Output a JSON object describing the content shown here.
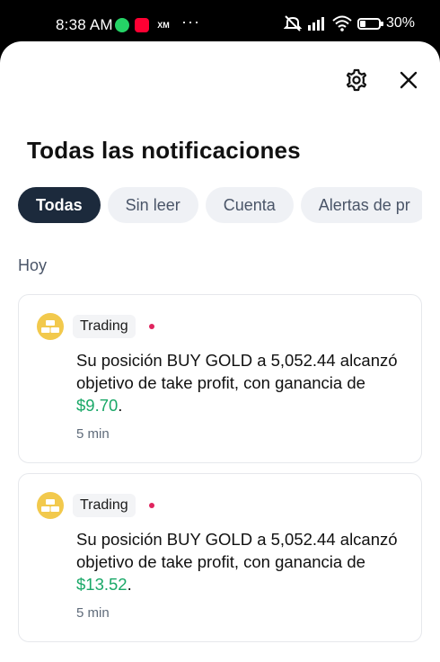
{
  "status_bar": {
    "time": "8:38 AM",
    "apps": [
      "whatsapp-icon",
      "youtube-icon",
      "xm-icon"
    ],
    "xm_label": "XM",
    "overflow": "···",
    "battery": "30%",
    "icons": [
      "mute-icon",
      "signal-icon",
      "wifi-icon",
      "battery-icon"
    ]
  },
  "header": {
    "title": "Todas las notificaciones",
    "settings_icon": "gear-icon",
    "close_icon": "close-icon"
  },
  "tabs": [
    {
      "label": "Todas",
      "active": true
    },
    {
      "label": "Sin leer",
      "active": false
    },
    {
      "label": "Cuenta",
      "active": false
    },
    {
      "label": "Alertas de pr",
      "active": false
    }
  ],
  "section": {
    "label": "Hoy"
  },
  "notifications": [
    {
      "category": "Trading",
      "unread": true,
      "message": "Su posición BUY GOLD a 5,052.44 alcanzó objetivo de take profit, con ganancia de",
      "amount": "$9.70",
      "suffix": ".",
      "time": "5 min"
    },
    {
      "category": "Trading",
      "unread": true,
      "message": "Su posición BUY GOLD a 5,052.44 alcanzó objetivo de take profit, con ganancia de",
      "amount": "$13.52",
      "suffix": ".",
      "time": "5 min"
    }
  ],
  "colors": {
    "accent_dark": "#1c2a3c",
    "profit": "#1aa868",
    "unread_dot": "#e0245e",
    "gold": "#f2c94c"
  }
}
